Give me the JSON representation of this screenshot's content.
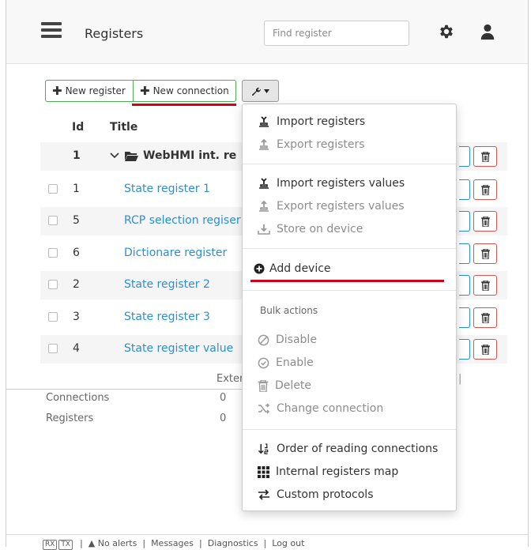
{
  "header": {
    "title": "Registers",
    "search_placeholder": "Find register"
  },
  "toolbar": {
    "new_register": "New register",
    "new_connection": "New connection"
  },
  "table": {
    "columns": [
      "Id",
      "Title"
    ],
    "group": {
      "id": "1",
      "title": "WebHMI int. re"
    },
    "rows": [
      {
        "id": "1",
        "title": "State register 1"
      },
      {
        "id": "5",
        "title": "RCP selection regiser"
      },
      {
        "id": "6",
        "title": "Dictionare register"
      },
      {
        "id": "2",
        "title": "State register 2"
      },
      {
        "id": "3",
        "title": "State register 3"
      },
      {
        "id": "4",
        "title": "State register value"
      }
    ]
  },
  "stats": {
    "column_header": "Exter",
    "connections_label": "Connections",
    "connections_value": "0",
    "registers_label": "Registers",
    "registers_value": "0"
  },
  "menu": {
    "import_registers": "Import registers",
    "export_registers": "Export registers",
    "import_values": "Import registers values",
    "export_values": "Export registers values",
    "store_on_device": "Store on device",
    "add_device": "Add device",
    "bulk_header": "Bulk actions",
    "disable": "Disable",
    "enable": "Enable",
    "delete": "Delete",
    "change_connection": "Change connection",
    "order_reading": "Order of reading connections",
    "internal_map": "Internal registers map",
    "custom_protocols": "Custom protocols"
  },
  "footer": {
    "rx": "RX",
    "tx": "TX",
    "alerts": "No alerts",
    "messages": "Messages",
    "diagnostics": "Diagnostics",
    "logout": "Log out"
  },
  "colors": {
    "link": "#2a8fd6",
    "success_border": "#4cae4c",
    "danger": "#d9534f",
    "highlight_underline": "#d0021b"
  }
}
